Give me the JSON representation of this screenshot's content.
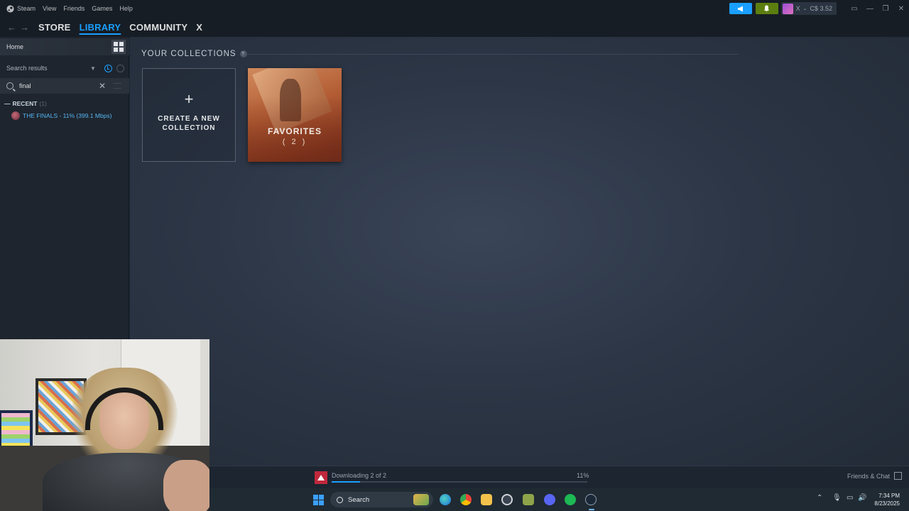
{
  "menubar": {
    "app": "Steam",
    "items": [
      "View",
      "Friends",
      "Games",
      "Help"
    ],
    "account_name": "X",
    "wallet": "C$ 3.52"
  },
  "nav": {
    "store": "STORE",
    "library": "LIBRARY",
    "community": "COMMUNITY",
    "profile": "X"
  },
  "sidebar": {
    "home": "Home",
    "filter_label": "Search results",
    "search_value": "final",
    "recent_label": "RECENT",
    "recent_count": "(1)",
    "game": "THE FINALS - 11% (399.1 Mbps)"
  },
  "collections": {
    "title": "YOUR COLLECTIONS",
    "help": "?",
    "new_plus": "+",
    "new_label": "CREATE A NEW COLLECTION",
    "favorites_label": "FAVORITES",
    "favorites_count": "( 2 )"
  },
  "downloads": {
    "status": "Downloading 2 of 2",
    "percent": "11%",
    "progress": 0.11
  },
  "friends": {
    "label": "Friends & Chat"
  },
  "taskbar": {
    "search": "Search",
    "time": "7:34 PM",
    "date": "8/23/2025"
  },
  "colors": {
    "accent": "#1a9fff",
    "notif": "#5c7e10",
    "background": "#1b2838"
  }
}
